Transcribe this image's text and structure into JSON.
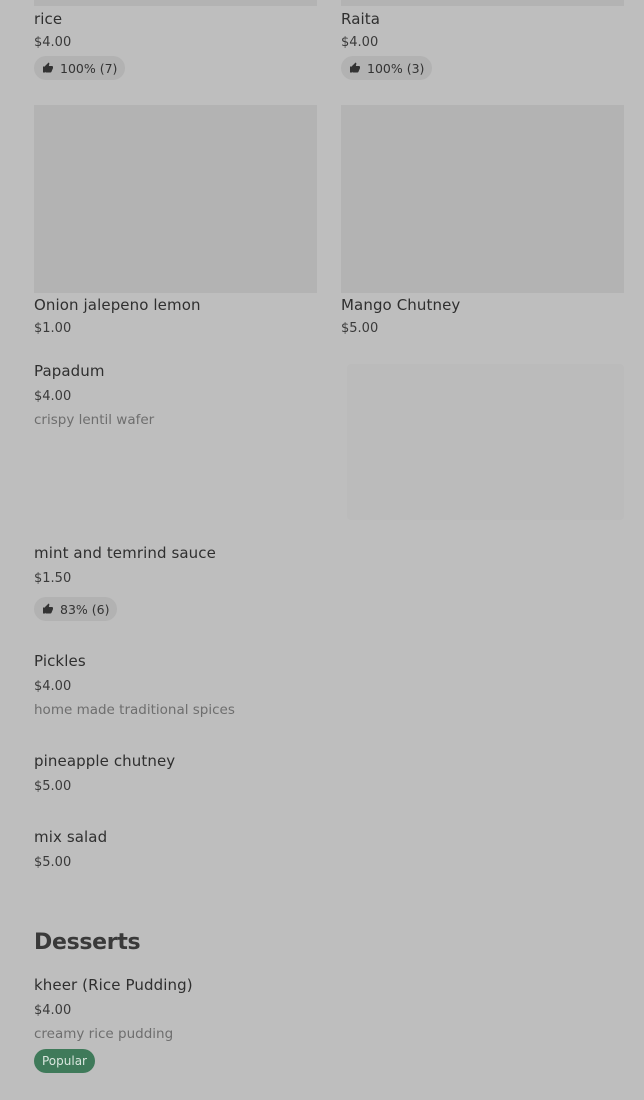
{
  "items": {
    "rice": {
      "name": "rice",
      "price": "$4.00",
      "rating": "100% (7)"
    },
    "raita": {
      "name": "Raita",
      "price": "$4.00",
      "rating": "100% (3)"
    },
    "onion": {
      "name": "Onion jalepeno lemon",
      "price": "$1.00"
    },
    "mango": {
      "name": "Mango Chutney",
      "price": "$5.00"
    },
    "papadum": {
      "name": "Papadum",
      "price": "$4.00",
      "description": "crispy lentil wafer"
    },
    "mint": {
      "name": "mint and temrind sauce",
      "price": "$1.50",
      "rating": "83% (6)"
    },
    "pickles": {
      "name": "Pickles",
      "price": "$4.00",
      "description": "home made traditional spices"
    },
    "pineapple": {
      "name": "pineapple chutney",
      "price": "$5.00"
    },
    "mixsalad": {
      "name": "mix salad",
      "price": "$5.00"
    }
  },
  "desserts": {
    "heading": "Desserts",
    "kheer": {
      "name": "kheer (Rice Pudding)",
      "price": "$4.00",
      "description": "creamy rice pudding",
      "badge": "Popular"
    }
  },
  "icons": {
    "rating": "thumbs-up-icon"
  },
  "colors": {
    "background": "#bebebe",
    "popular_badge": "#3f7a5a",
    "image_placeholder": "#b3b3b3"
  }
}
